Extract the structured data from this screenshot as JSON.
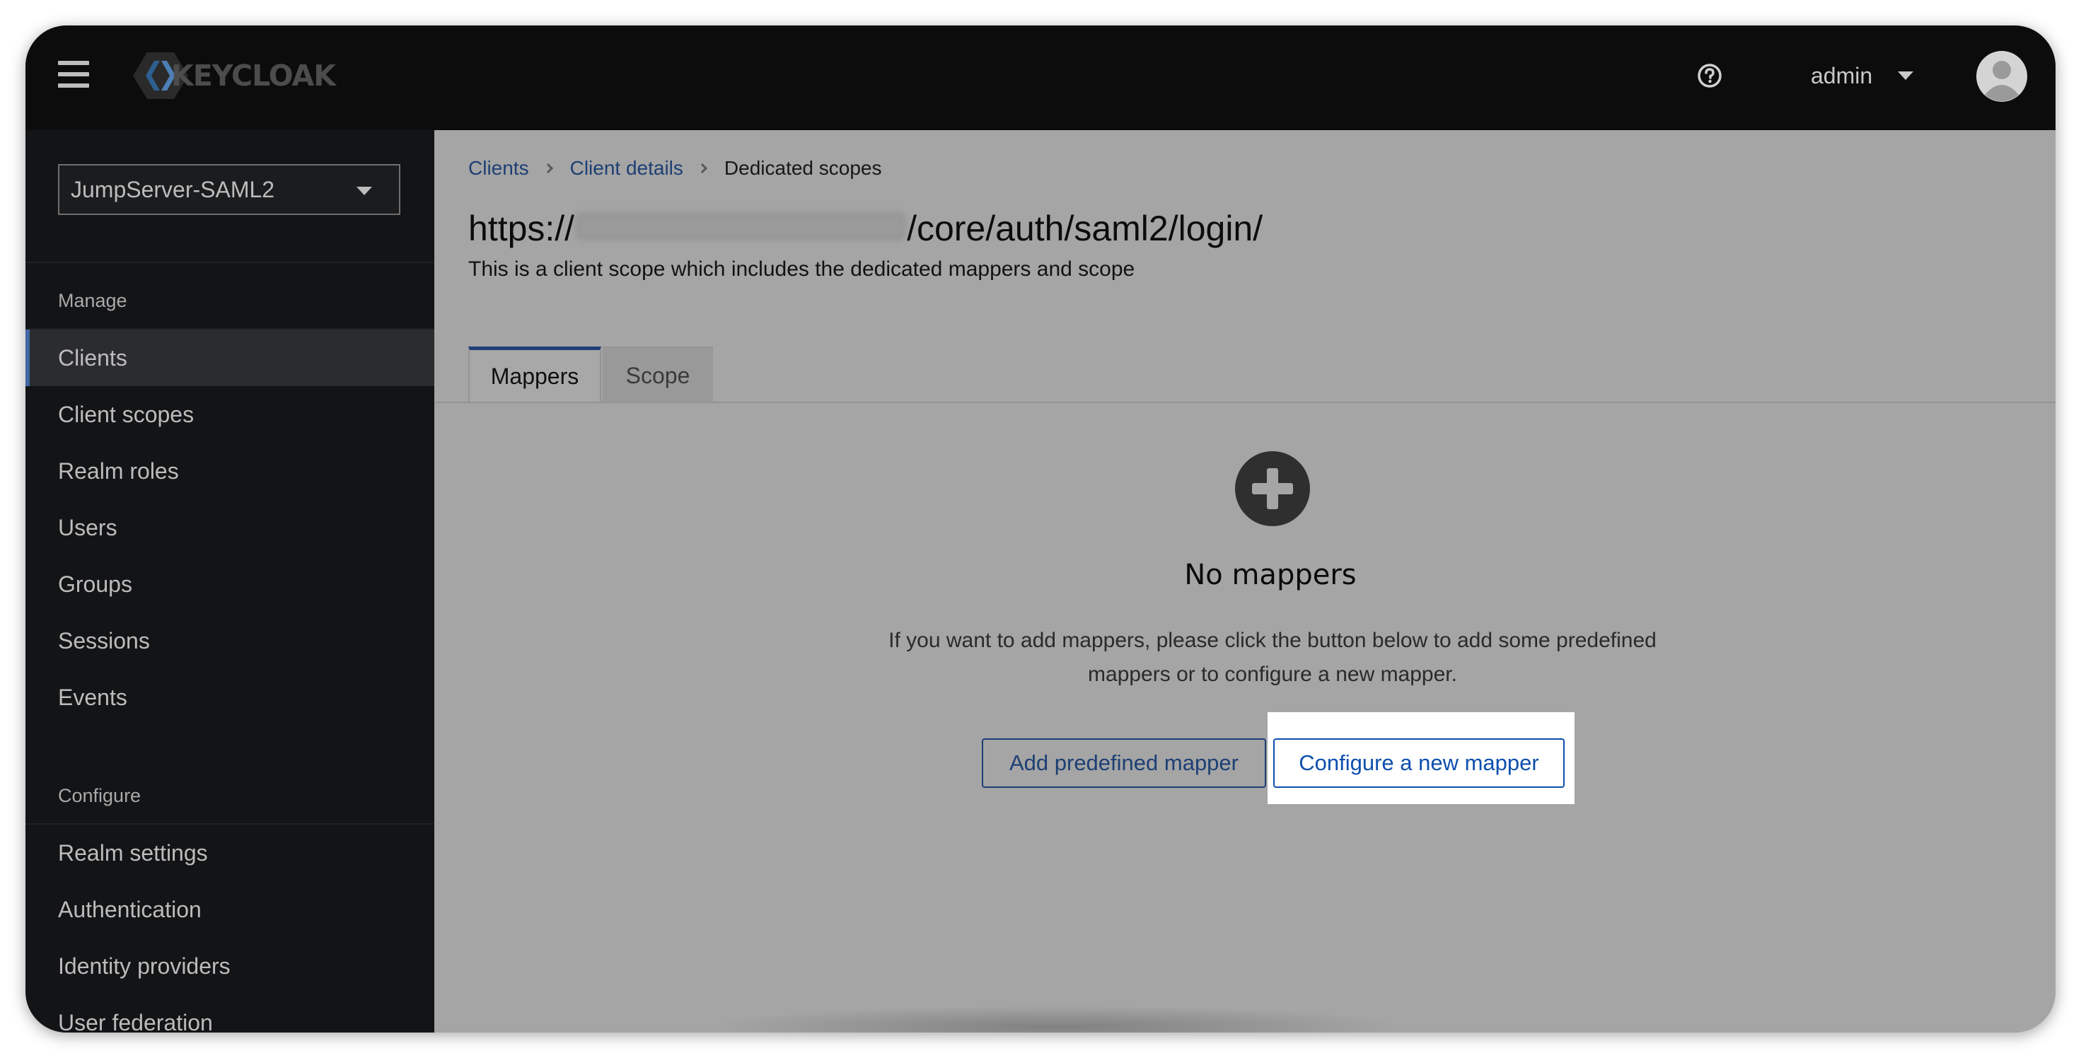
{
  "header": {
    "logo_text": "KEYCLOAK",
    "user": "admin"
  },
  "sidebar": {
    "realm": "JumpServer-SAML2",
    "sections": [
      {
        "label": "Manage",
        "items": [
          "Clients",
          "Client scopes",
          "Realm roles",
          "Users",
          "Groups",
          "Sessions",
          "Events"
        ]
      },
      {
        "label": "Configure",
        "items": [
          "Realm settings",
          "Authentication",
          "Identity providers",
          "User federation"
        ]
      }
    ],
    "active_item": "Clients"
  },
  "main": {
    "breadcrumb": [
      "Clients",
      "Client details",
      "Dedicated scopes"
    ],
    "title_prefix": "https://",
    "title_suffix": "/core/auth/saml2/login/",
    "description": "This is a client scope which includes the dedicated mappers and scope",
    "tabs": [
      "Mappers",
      "Scope"
    ],
    "empty_state": {
      "title": "No mappers",
      "body": "If you want to add mappers, please click the button below to add some predefined mappers or to configure a new mapper.",
      "primary_button": "Add predefined mapper",
      "secondary_button": "Configure a new mapper"
    }
  },
  "colors": {
    "masthead": "#0c0c0c",
    "sidebar": "#131416",
    "link": "#1d3f74",
    "button_highlight": "#0d4fad",
    "active_indicator": "#3f67a4"
  }
}
